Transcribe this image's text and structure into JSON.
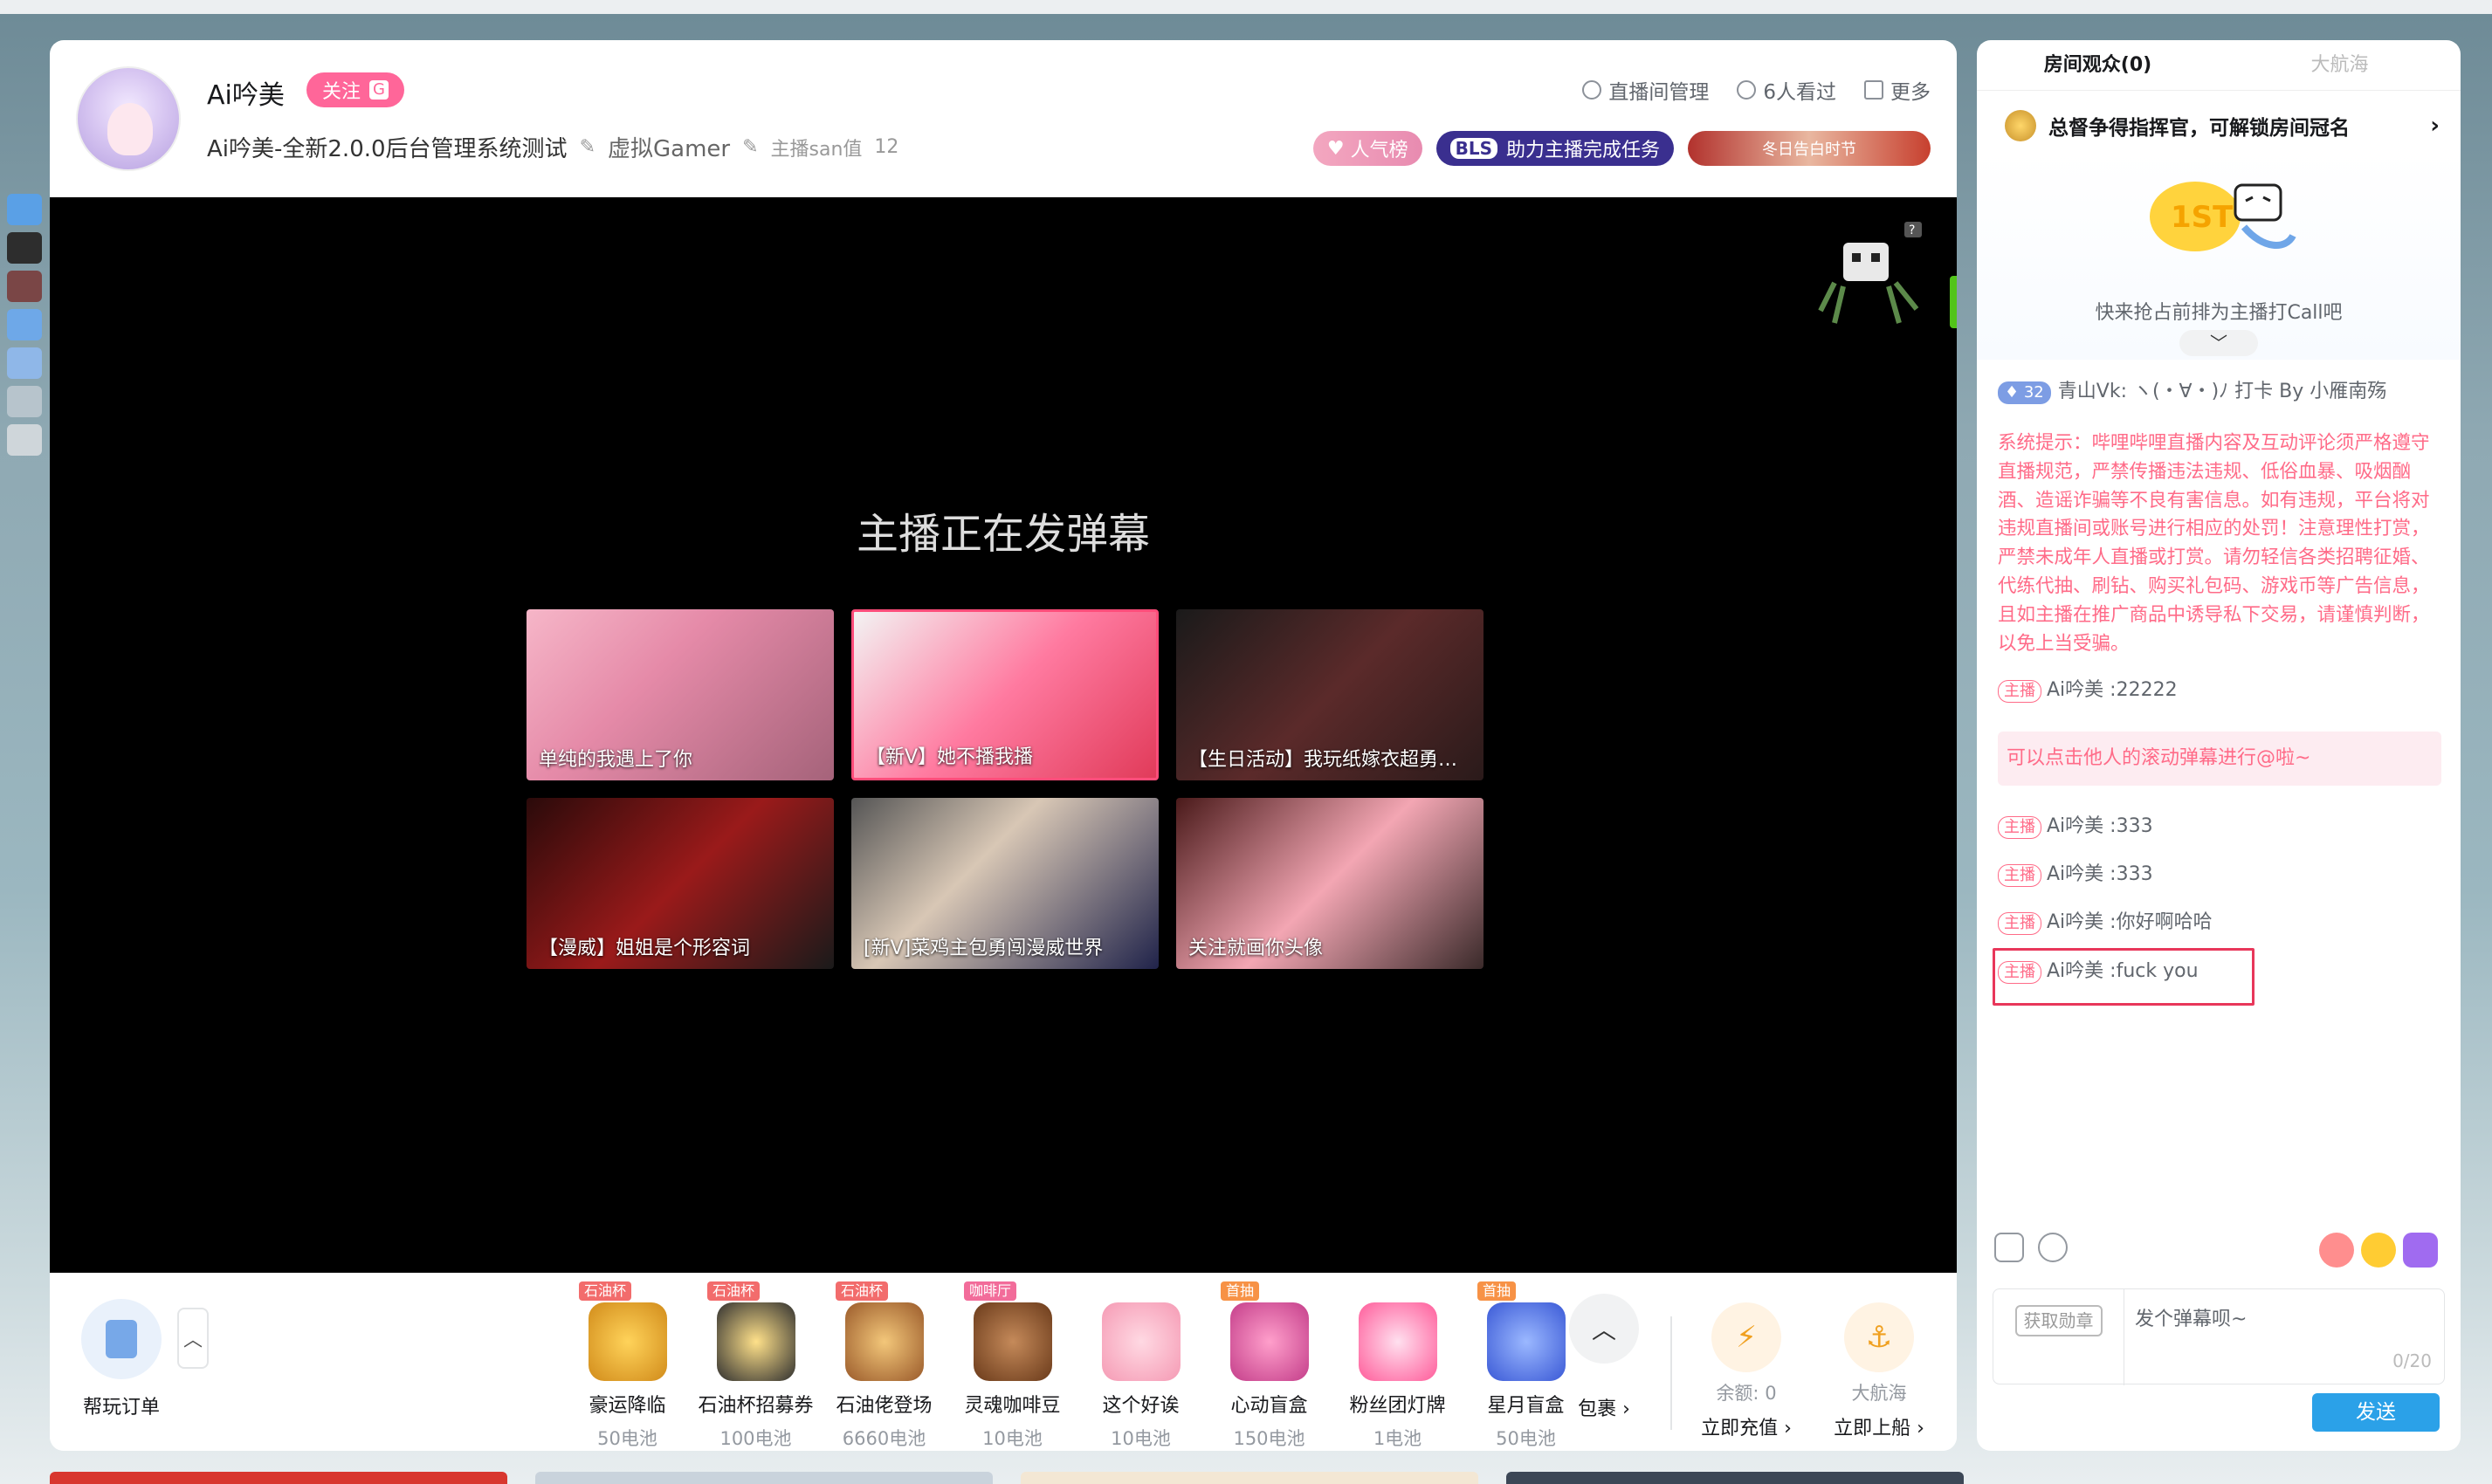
{
  "header": {
    "anchor_name": "Ai吟美",
    "follow_label": "关注",
    "follow_badge": "G",
    "room_title": "Ai吟美-全新2.0.0后台管理系统测试",
    "area": "虚拟Gamer",
    "san_label": "主播san值",
    "san_value": "12",
    "actions": [
      {
        "icon": "settings-icon",
        "label": "直播间管理"
      },
      {
        "icon": "eye-icon",
        "label": "6人看过"
      },
      {
        "icon": "more-icon",
        "label": "更多"
      }
    ],
    "badges": {
      "popularity": "人气榜",
      "bls_logo": "BLS",
      "bls_label": "助力主播完成任务",
      "banner": "冬日告白时节"
    }
  },
  "player": {
    "message": "主播正在发弹幕",
    "recommendations": [
      {
        "caption": "单纯的我遇上了你"
      },
      {
        "caption": "【新V】她不播我播"
      },
      {
        "caption": "【生日活动】我玩纸嫁衣超勇…"
      },
      {
        "caption": "【漫威】姐姐是个形容词"
      },
      {
        "caption": "[新V]菜鸡主包勇闯漫威世界"
      },
      {
        "caption": "关注就画你头像"
      }
    ]
  },
  "giftbar": {
    "help_label": "帮玩订单",
    "gifts": [
      {
        "tag": "石油杯",
        "name": "豪运降临",
        "price": "50电池"
      },
      {
        "tag": "石油杯",
        "name": "石油杯招募券",
        "price": "100电池"
      },
      {
        "tag": "石油杯",
        "name": "石油佬登场",
        "price": "6660电池"
      },
      {
        "tag": "咖啡厅",
        "name": "灵魂咖啡豆",
        "price": "10电池"
      },
      {
        "tag": "",
        "name": "这个好诶",
        "price": "10电池"
      },
      {
        "tag": "首抽",
        "name": "心动盲盒",
        "price": "150电池"
      },
      {
        "tag": "",
        "name": "粉丝团灯牌",
        "price": "1电池"
      },
      {
        "tag": "首抽",
        "name": "星月盲盒",
        "price": "50电池"
      }
    ],
    "package_label": "包裹",
    "balance": "余额: 0",
    "recharge": "立即充值",
    "fleet_title": "大航海",
    "fleet_action": "立即上船"
  },
  "side": {
    "tabs": [
      "房间观众(0)",
      "大航海"
    ],
    "rank_text": "总督争得指挥官，可解锁房间冠名",
    "call_text": "快来抢占前排为主播打Call吧",
    "first_msg": {
      "level": "32",
      "user": "青山Vk",
      "text": ": ヽ(・∀・)ﾉ 打卡 By 小雁南殇"
    },
    "system_notice": "系统提示：哔哩哔哩直播内容及互动评论须严格遵守直播规范，严禁传播违法违规、低俗血暴、吸烟酗酒、造谣诈骗等不良有害信息。如有违规，平台将对违规直播间或账号进行相应的处罚！注意理性打赏，严禁未成年人直播或打赏。请勿轻信各类招聘征婚、代练代抽、刷钻、购买礼包码、游戏币等广告信息，且如主播在推广商品中诱导私下交易，请谨慎判断，以免上当受骗。",
    "host_tag": "主播",
    "tip": "可以点击他人的滚动弹幕进行@啦~",
    "messages": [
      {
        "user": "Ai吟美",
        "text": ":22222"
      },
      {
        "user": "Ai吟美",
        "text": ":333"
      },
      {
        "user": "Ai吟美",
        "text": ":333"
      },
      {
        "user": "Ai吟美",
        "text": ":你好啊哈哈"
      },
      {
        "user": "Ai吟美",
        "text": ":fuck you"
      }
    ],
    "medal_button": "获取勋章",
    "input_placeholder": "发个弹幕呗~",
    "input_count": "0/20",
    "send_label": "发送"
  }
}
